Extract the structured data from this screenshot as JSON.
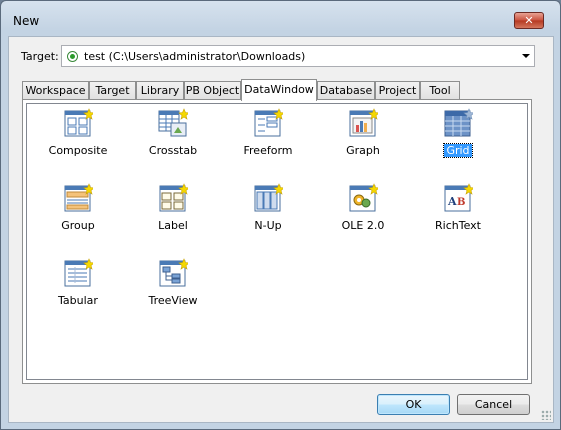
{
  "window": {
    "title": "New",
    "close_label": "✕"
  },
  "target": {
    "label": "Target:",
    "value": "test (C:\\Users\\administrator\\Downloads)"
  },
  "tabs": [
    {
      "label": "Workspace",
      "active": false
    },
    {
      "label": "Target",
      "active": false
    },
    {
      "label": "Library",
      "active": false
    },
    {
      "label": "PB Object",
      "active": false
    },
    {
      "label": "DataWindow",
      "active": true
    },
    {
      "label": "Database",
      "active": false
    },
    {
      "label": "Project",
      "active": false
    },
    {
      "label": "Tool",
      "active": false
    }
  ],
  "items": [
    {
      "label": "Composite",
      "icon": "composite-icon",
      "selected": false
    },
    {
      "label": "Crosstab",
      "icon": "crosstab-icon",
      "selected": false
    },
    {
      "label": "Freeform",
      "icon": "freeform-icon",
      "selected": false
    },
    {
      "label": "Graph",
      "icon": "graph-icon",
      "selected": false
    },
    {
      "label": "Grid",
      "icon": "grid-icon",
      "selected": true
    },
    {
      "label": "Group",
      "icon": "group-icon",
      "selected": false
    },
    {
      "label": "Label",
      "icon": "label-icon",
      "selected": false
    },
    {
      "label": "N-Up",
      "icon": "n-up-icon",
      "selected": false
    },
    {
      "label": "OLE 2.0",
      "icon": "ole-icon",
      "selected": false
    },
    {
      "label": "RichText",
      "icon": "richtext-icon",
      "selected": false
    },
    {
      "label": "Tabular",
      "icon": "tabular-icon",
      "selected": false
    },
    {
      "label": "TreeView",
      "icon": "treeview-icon",
      "selected": false
    }
  ],
  "buttons": {
    "ok": "OK",
    "cancel": "Cancel"
  },
  "colors": {
    "selection": "#3399ff",
    "icon_blue": "#4a7ab5",
    "icon_star": "#f5d800"
  }
}
